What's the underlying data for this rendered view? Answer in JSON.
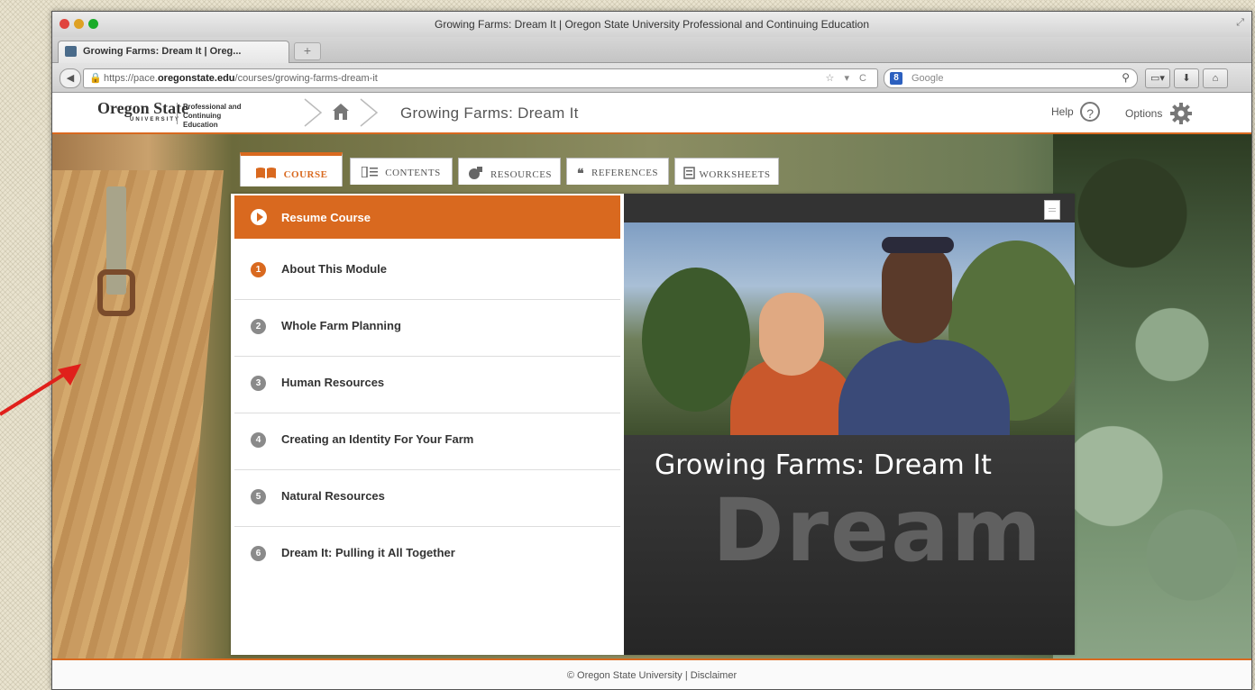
{
  "window": {
    "title": "Growing Farms: Dream It | Oregon State University Professional and Continuing Education"
  },
  "browser": {
    "tab_title": "Growing Farms: Dream It | Oreg...",
    "new_tab": "+",
    "url_prefix": "https://pace.",
    "url_domain": "oregonstate.edu",
    "url_path": "/courses/growing-farms-dream-it",
    "search_engine": "Google"
  },
  "header": {
    "logo_name": "Oregon State",
    "logo_university": "UNIVERSITY",
    "logo_sub": "Professional and Continuing Education",
    "course_title": "Growing Farms: Dream It",
    "help_label": "Help",
    "help_icon": "?",
    "options_label": "Options"
  },
  "tabs": [
    {
      "label": "COURSE",
      "icon": "book-icon",
      "active": true
    },
    {
      "label": "CONTENTS",
      "icon": "contents-icon",
      "active": false
    },
    {
      "label": "RESOURCES",
      "icon": "resources-icon",
      "active": false
    },
    {
      "label": "REFERENCES",
      "icon": "quote-icon",
      "active": false
    },
    {
      "label": "WORKSHEETS",
      "icon": "worksheet-icon",
      "active": false
    }
  ],
  "menu": {
    "resume_label": "Resume Course",
    "items": [
      {
        "num": "1",
        "label": "About This Module"
      },
      {
        "num": "2",
        "label": "Whole Farm Planning"
      },
      {
        "num": "3",
        "label": "Human Resources"
      },
      {
        "num": "4",
        "label": "Creating an Identity For Your Farm"
      },
      {
        "num": "5",
        "label": "Natural Resources"
      },
      {
        "num": "6",
        "label": "Dream It: Pulling it All Together"
      }
    ]
  },
  "media": {
    "title": "Growing Farms: Dream It",
    "background_word": "Dream"
  },
  "footer": {
    "text": "© Oregon State University | Disclaimer"
  },
  "colors": {
    "accent": "#d9691f",
    "annotation_arrow": "#e0201b"
  }
}
